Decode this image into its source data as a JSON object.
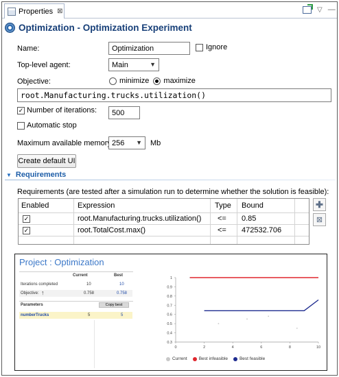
{
  "view_tab": {
    "title": "Properties",
    "close_glyph": "⊠"
  },
  "header": {
    "title": "Optimization - Optimization Experiment",
    "icon": "experiment-gear-icon"
  },
  "form": {
    "name_label": "Name:",
    "name_value": "Optimization",
    "ignore_label": "Ignore",
    "ignore_checked": false,
    "top_level_agent_label": "Top-level agent:",
    "top_level_agent_value": "Main",
    "objective_label": "Objective:",
    "minimize_label": "minimize",
    "maximize_label": "maximize",
    "objective_selected": "maximize",
    "objective_expression": "root.Manufacturing.trucks.utilization()",
    "iterations_label": "Number of iterations:",
    "iterations_checked": true,
    "iterations_value": "500",
    "automatic_stop_label": "Automatic stop",
    "automatic_stop_checked": false,
    "memory_label": "Maximum available memory:",
    "memory_value": "256",
    "memory_unit": "Mb",
    "create_ui_button": "Create default UI"
  },
  "requirements": {
    "section_title": "Requirements",
    "description": "Requirements (are tested after a simulation run to determine whether the solution is feasible):",
    "columns": [
      "Enabled",
      "Expression",
      "Type",
      "Bound"
    ],
    "rows": [
      {
        "enabled": true,
        "expression": "root.Manufacturing.trucks.utilization()",
        "type": "<=",
        "bound": "0.85"
      },
      {
        "enabled": true,
        "expression": "root.TotalCost.max()",
        "type": "<=",
        "bound": "472532.706"
      }
    ],
    "add_icon": "add-icon",
    "remove_icon": "remove-icon"
  },
  "preview": {
    "title": "Project : Optimization",
    "col_current": "Current",
    "col_best": "Best",
    "iterations_completed_label": "Iterations completed",
    "iterations_current": "10",
    "iterations_best": "10",
    "objective_label": "Objective:",
    "objective_arrow": "↑",
    "objective_current": "0.758",
    "objective_best": "0.758",
    "parameters_label": "Parameters",
    "copy_best_label": "Copy best",
    "param_name": "numberTrucks",
    "param_current": "5",
    "param_best": "5",
    "legend": [
      {
        "label": "Current",
        "color": "#c8c8c8"
      },
      {
        "label": "Best infeasible",
        "color": "#e0262d"
      },
      {
        "label": "Best feasible",
        "color": "#1e2b8f"
      }
    ]
  },
  "chart_data": {
    "type": "line",
    "title": "",
    "xlabel": "",
    "ylabel": "",
    "xlim": [
      0,
      10
    ],
    "ylim": [
      0.3,
      1
    ],
    "x_ticks": [
      "0",
      "2",
      "4",
      "6",
      "8",
      "10"
    ],
    "y_ticks": [
      "0.3",
      "0.4",
      "0.5",
      "0.6",
      "0.7",
      "0.8",
      "0.9",
      "1"
    ],
    "series": [
      {
        "name": "Best infeasible",
        "color": "#e0262d",
        "x": [
          1,
          10
        ],
        "y": [
          1.0,
          1.0
        ]
      },
      {
        "name": "Best feasible",
        "color": "#1e2b8f",
        "x": [
          2,
          9,
          10
        ],
        "y": [
          0.64,
          0.64,
          0.758
        ]
      }
    ],
    "current_points": {
      "name": "Current",
      "color": "#c8c8c8",
      "x": [
        1,
        3,
        5,
        6.5,
        8.5
      ],
      "y": [
        1.0,
        0.5,
        0.55,
        0.58,
        0.45
      ]
    }
  }
}
